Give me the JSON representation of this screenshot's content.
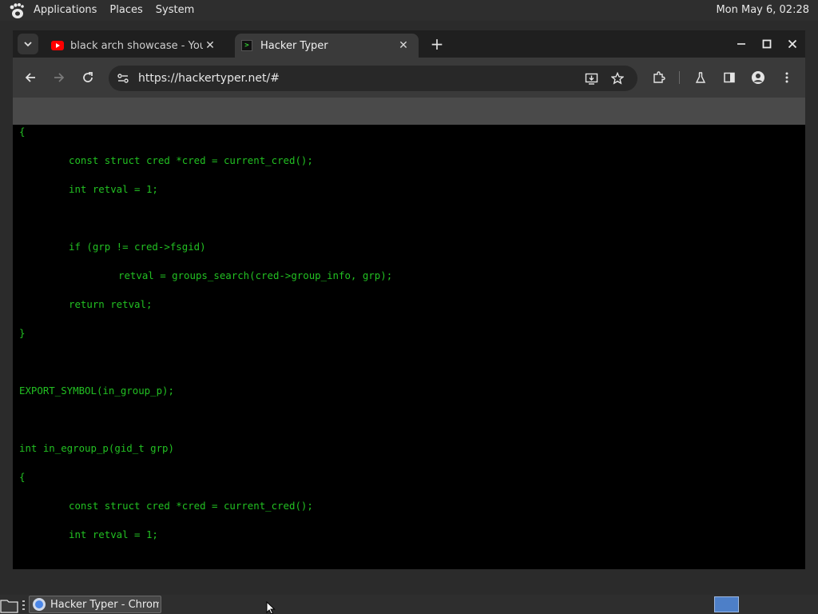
{
  "top_panel": {
    "menus": [
      "Applications",
      "Places",
      "System"
    ],
    "clock": "Mon May  6, 02:28"
  },
  "browser": {
    "tabs": [
      {
        "title": "black arch showcase - YouTube",
        "favicon": "youtube-icon",
        "active": false
      },
      {
        "title": "Hacker Typer",
        "favicon": "terminal-icon",
        "active": true
      }
    ],
    "url": "https://hackertyper.net/#"
  },
  "terminal": {
    "text_color": "#22c022",
    "lines": [
      {
        "text": "{",
        "indent": 0
      },
      {
        "text": "",
        "indent": 0
      },
      {
        "text": "const struct cred *cred = current_cred();",
        "indent": 1
      },
      {
        "text": "",
        "indent": 0
      },
      {
        "text": "int retval = 1;",
        "indent": 1
      },
      {
        "text": "",
        "indent": 0
      },
      {
        "text": "",
        "indent": 0
      },
      {
        "text": "",
        "indent": 0
      },
      {
        "text": "if (grp != cred->fsgid)",
        "indent": 1
      },
      {
        "text": "",
        "indent": 0
      },
      {
        "text": "retval = groups_search(cred->group_info, grp);",
        "indent": 2
      },
      {
        "text": "",
        "indent": 0
      },
      {
        "text": "return retval;",
        "indent": 1
      },
      {
        "text": "",
        "indent": 0
      },
      {
        "text": "}",
        "indent": 0
      },
      {
        "text": "",
        "indent": 0
      },
      {
        "text": "",
        "indent": 0
      },
      {
        "text": "",
        "indent": 0
      },
      {
        "text": "EXPORT_SYMBOL(in_group_p);",
        "indent": 0
      },
      {
        "text": "",
        "indent": 0
      },
      {
        "text": "",
        "indent": 0
      },
      {
        "text": "",
        "indent": 0
      },
      {
        "text": "int in_egroup_p(gid_t grp)",
        "indent": 0
      },
      {
        "text": "",
        "indent": 0
      },
      {
        "text": "{",
        "indent": 0
      },
      {
        "text": "",
        "indent": 0
      },
      {
        "text": "const struct cred *cred = current_cred();",
        "indent": 1
      },
      {
        "text": "",
        "indent": 0
      },
      {
        "text": "int retval = 1;",
        "indent": 1
      }
    ]
  },
  "taskbar": {
    "items": [
      {
        "title": "Hacker Typer - Chromium",
        "icon": "chromium-icon"
      }
    ]
  }
}
